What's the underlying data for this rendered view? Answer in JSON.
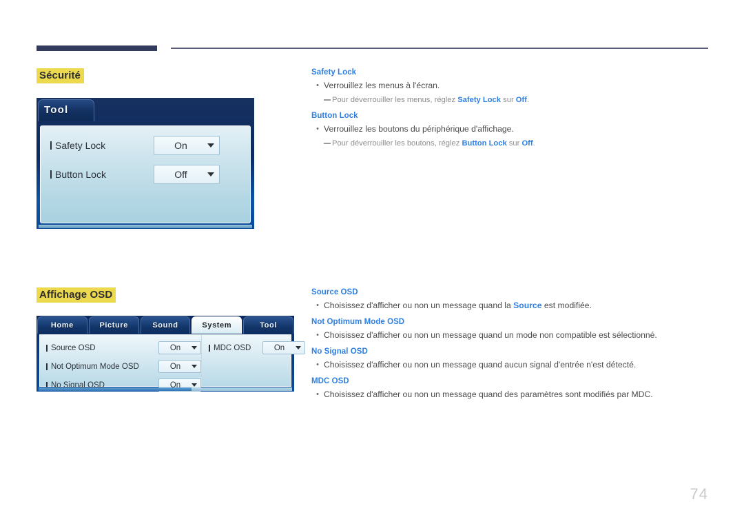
{
  "page": {
    "number": "74"
  },
  "sections": [
    {
      "heading": "Sécurité",
      "osd": {
        "tab_label": "Tool",
        "rows": [
          {
            "label": "Safety Lock",
            "value": "On"
          },
          {
            "label": "Button Lock",
            "value": "Off"
          }
        ]
      },
      "entries": [
        {
          "term": "Safety Lock",
          "bullet": "Verrouillez les menus à l'écran.",
          "note_before": "Pour déverrouiller les menus, réglez ",
          "note_bold1": "Safety Lock",
          "note_mid": " sur ",
          "note_bold2": "Off",
          "note_after": "."
        },
        {
          "term": "Button Lock",
          "bullet": "Verrouillez les boutons du périphérique d'affichage.",
          "note_before": "Pour déverrouiller les boutons, réglez ",
          "note_bold1": "Button Lock",
          "note_mid": " sur ",
          "note_bold2": "Off",
          "note_after": "."
        }
      ]
    },
    {
      "heading": "Affichage OSD",
      "osd": {
        "tabs": [
          "Home",
          "Picture",
          "Sound",
          "System",
          "Tool"
        ],
        "active_tab": "System",
        "left_rows": [
          {
            "label": "Source OSD",
            "value": "On"
          },
          {
            "label": "Not Optimum Mode OSD",
            "value": "On"
          },
          {
            "label": "No Signal OSD",
            "value": "On"
          }
        ],
        "right_rows": [
          {
            "label": "MDC OSD",
            "value": "On"
          }
        ]
      },
      "entries": [
        {
          "term": "Source OSD",
          "bullet_before": "Choisissez d'afficher ou non un message quand la ",
          "bullet_bold": "Source",
          "bullet_after": " est modifiée."
        },
        {
          "term": "Not Optimum Mode OSD",
          "bullet_before": "Choisissez d'afficher ou non un message quand un mode non compatible est sélectionné.",
          "bullet_bold": "",
          "bullet_after": ""
        },
        {
          "term": "No Signal OSD",
          "bullet_before": "Choisissez d'afficher ou non un message quand aucun signal d'entrée n'est détecté.",
          "bullet_bold": "",
          "bullet_after": ""
        },
        {
          "term": "MDC OSD",
          "bullet_before": "Choisissez d'afficher ou non un message quand des paramètres sont modifiés par MDC.",
          "bullet_bold": "",
          "bullet_after": ""
        }
      ]
    }
  ],
  "colors": {
    "header_bar": "#323a5e",
    "heading_highlight": "#ecd94e",
    "term_blue": "#2f7fe0",
    "page_number": "#c9c9c9"
  }
}
